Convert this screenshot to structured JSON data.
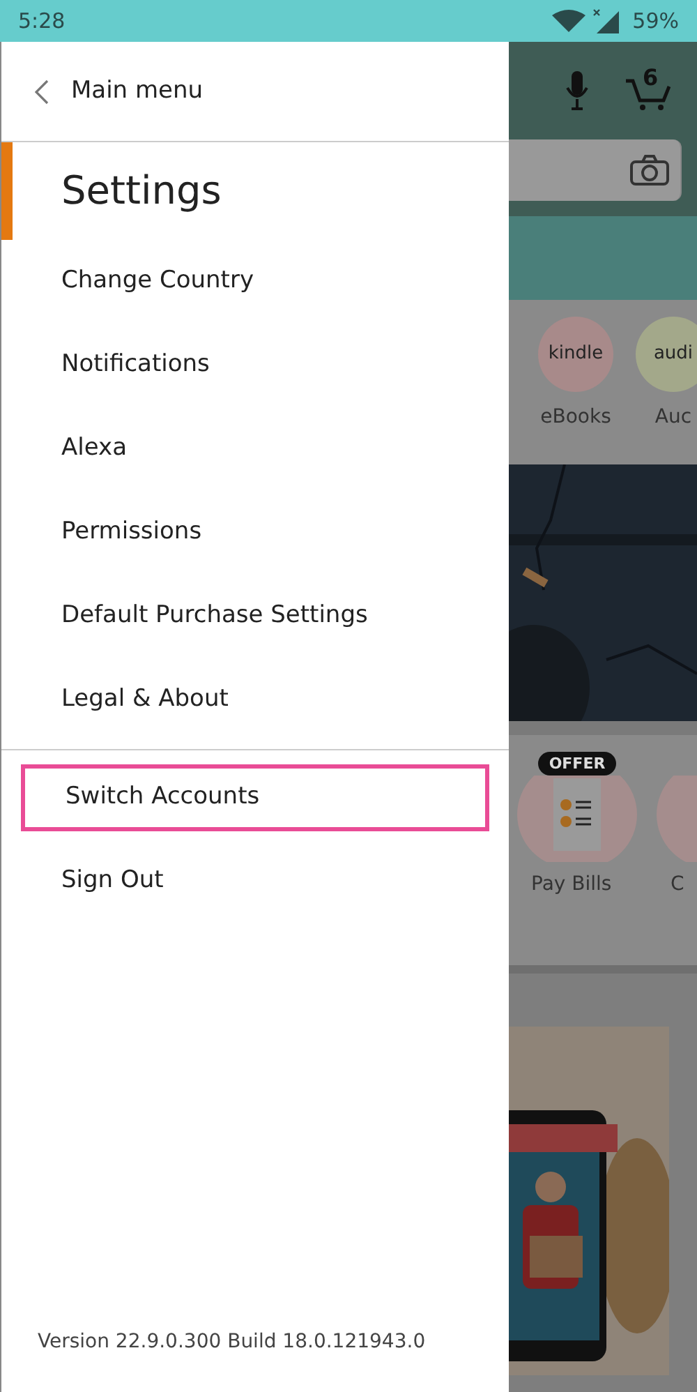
{
  "status_bar": {
    "time": "5:28",
    "battery": "59%"
  },
  "drawer": {
    "back_label": "Main menu",
    "title": "Settings",
    "sections": [
      [
        {
          "label": "Change Country",
          "highlighted": false
        },
        {
          "label": "Notifications",
          "highlighted": false
        },
        {
          "label": "Alexa",
          "highlighted": false
        },
        {
          "label": "Permissions",
          "highlighted": false
        },
        {
          "label": "Default Purchase Settings",
          "highlighted": false
        },
        {
          "label": "Legal & About",
          "highlighted": false
        }
      ],
      [
        {
          "label": "Switch Accounts",
          "highlighted": true
        },
        {
          "label": "Sign Out",
          "highlighted": false
        }
      ]
    ],
    "version": "Version 22.9.0.300 Build 18.0.121943.0"
  },
  "background_app": {
    "cart_count": "6",
    "categories": [
      {
        "badge": "kindle",
        "label": "eBooks",
        "color": "#a88a8a"
      },
      {
        "badge": "audi",
        "label": "Auc",
        "color": "#a3a88a"
      }
    ],
    "tiles": [
      {
        "badge": "OFFER",
        "label": "Pay Bills"
      },
      {
        "label": "C"
      }
    ]
  }
}
